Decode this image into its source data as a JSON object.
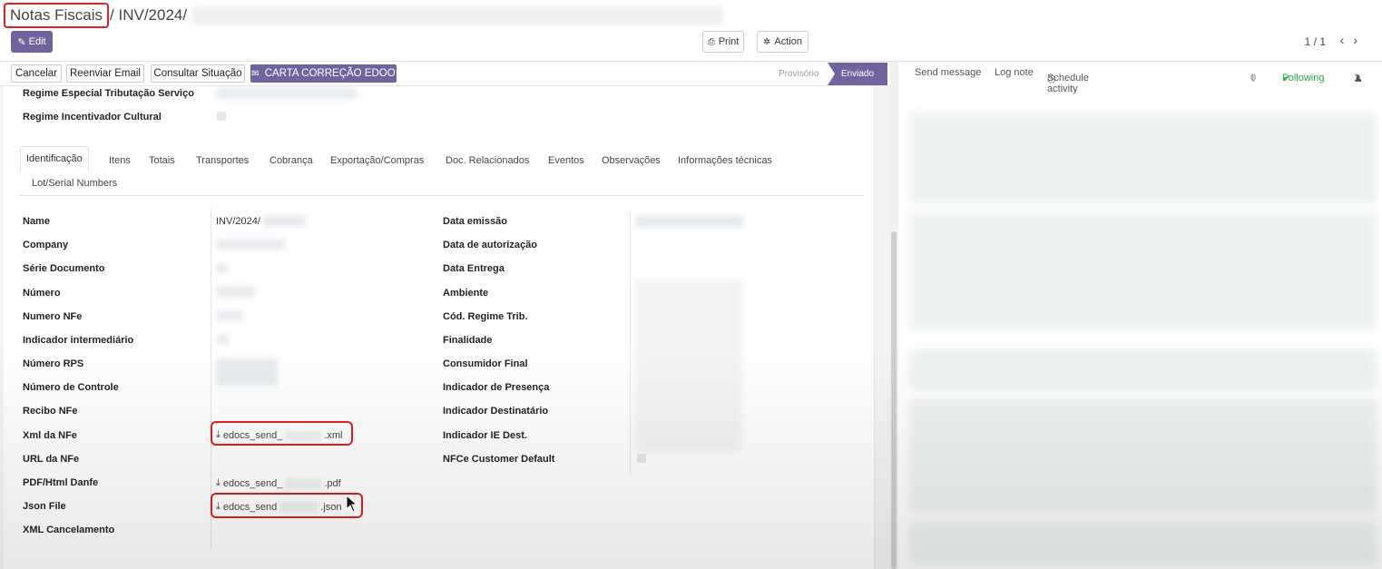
{
  "breadcrumb": {
    "first": "Notas Fiscais",
    "rest": "/ INV/2024/"
  },
  "toolbar": {
    "edit": "Edit",
    "print": "Print",
    "action": "Action",
    "pager": "1 / 1",
    "prev": "‹",
    "next": "›"
  },
  "status_buttons": {
    "cancelar": "Cancelar",
    "reenviar": "Reenviar Email",
    "consultar": "Consultar Situação",
    "carta": "CARTA CORREÇÃO EDOO"
  },
  "stages": {
    "provisorio": "Provisório",
    "enviado": "Enviado"
  },
  "top_fields": {
    "regime_especial": "Regime Especial Tributação Serviço",
    "regime_incentivador": "Regime Incentivador Cultural"
  },
  "tabs": [
    "Identificação",
    "Itens",
    "Totais",
    "Transportes",
    "Cobrança",
    "Exportação/Compras",
    "Doc. Relacionados",
    "Eventos",
    "Observações",
    "Informações técnicas",
    "Lot/Serial Numbers"
  ],
  "left_labels": [
    "Name",
    "Company",
    "Série Documento",
    "Número",
    "Numero NFe",
    "Indicador intermediário",
    "Número RPS",
    "Número de Controle",
    "Recibo NFe",
    "Xml da NFe",
    "URL da NFe",
    "PDF/Html Danfe",
    "Json File",
    "XML Cancelamento"
  ],
  "name_value": "INV/2024/",
  "files": {
    "xml": {
      "prefix": "edocs_send_",
      "suffix": ".xml"
    },
    "pdf": {
      "prefix": "edocs_send_",
      "suffix": ".pdf"
    },
    "json": {
      "prefix": "edocs_send",
      "suffix": ".json"
    }
  },
  "right_labels": [
    "Data emissão",
    "Data de autorização",
    "Data Entrega",
    "Ambiente",
    "Cód. Regime Trib.",
    "Finalidade",
    "Consumidor Final",
    "Indicador de Presença",
    "Indicador Destinatário",
    "Indicador IE Dest.",
    "NFCe Customer Default"
  ],
  "chatter": {
    "send_message": "Send message",
    "log_note": "Log note",
    "schedule": "Schedule activity",
    "attachments": "0",
    "following": "Following",
    "followers": "1"
  },
  "colors": {
    "primary": "#71639e",
    "highlight": "#e02020",
    "following": "#28a745"
  },
  "icons": [
    "pencil-icon",
    "printer-icon",
    "gear-icon",
    "envelope-icon",
    "download-icon",
    "paperclip-icon",
    "check-icon",
    "user-icon",
    "clock-icon",
    "mouse-cursor-icon"
  ]
}
